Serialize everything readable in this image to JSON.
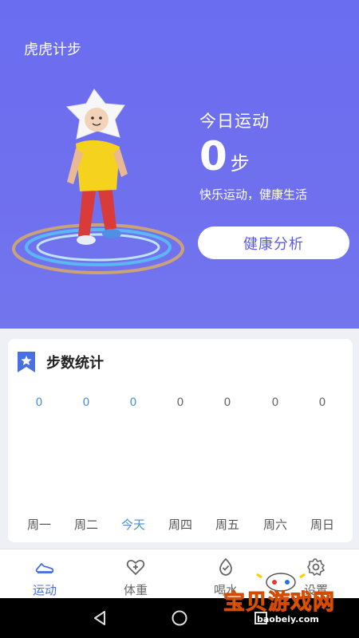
{
  "app": {
    "title": "虎虎计步"
  },
  "today": {
    "label": "今日运动",
    "steps": "0",
    "unit": "步",
    "slogan": "快乐运动，健康生活",
    "analysis_button": "健康分析"
  },
  "stats": {
    "title": "步数统计",
    "days": [
      {
        "name": "周一",
        "value": "0",
        "color": "#4a8fd6"
      },
      {
        "name": "周二",
        "value": "0",
        "color": "#4a8fd6"
      },
      {
        "name": "今天",
        "value": "0",
        "color": "#4a8fd6"
      },
      {
        "name": "周四",
        "value": "0",
        "color": "#666666"
      },
      {
        "name": "周五",
        "value": "0",
        "color": "#666666"
      },
      {
        "name": "周六",
        "value": "0",
        "color": "#666666"
      },
      {
        "name": "周日",
        "value": "0",
        "color": "#666666"
      }
    ]
  },
  "tabs": [
    {
      "label": "运动",
      "icon": "sneaker-icon",
      "active": true
    },
    {
      "label": "体重",
      "icon": "heart-plus-icon",
      "active": false
    },
    {
      "label": "喝水",
      "icon": "check-shield-icon",
      "active": false
    },
    {
      "label": "设置",
      "icon": "gear-icon",
      "active": false
    }
  ],
  "watermark": {
    "text": "宝贝游戏网",
    "sub": "baobeiy.com"
  },
  "colors": {
    "primary": "#6a6df0",
    "accent": "#4a6fe0",
    "today_blue": "#4a8fd6"
  }
}
